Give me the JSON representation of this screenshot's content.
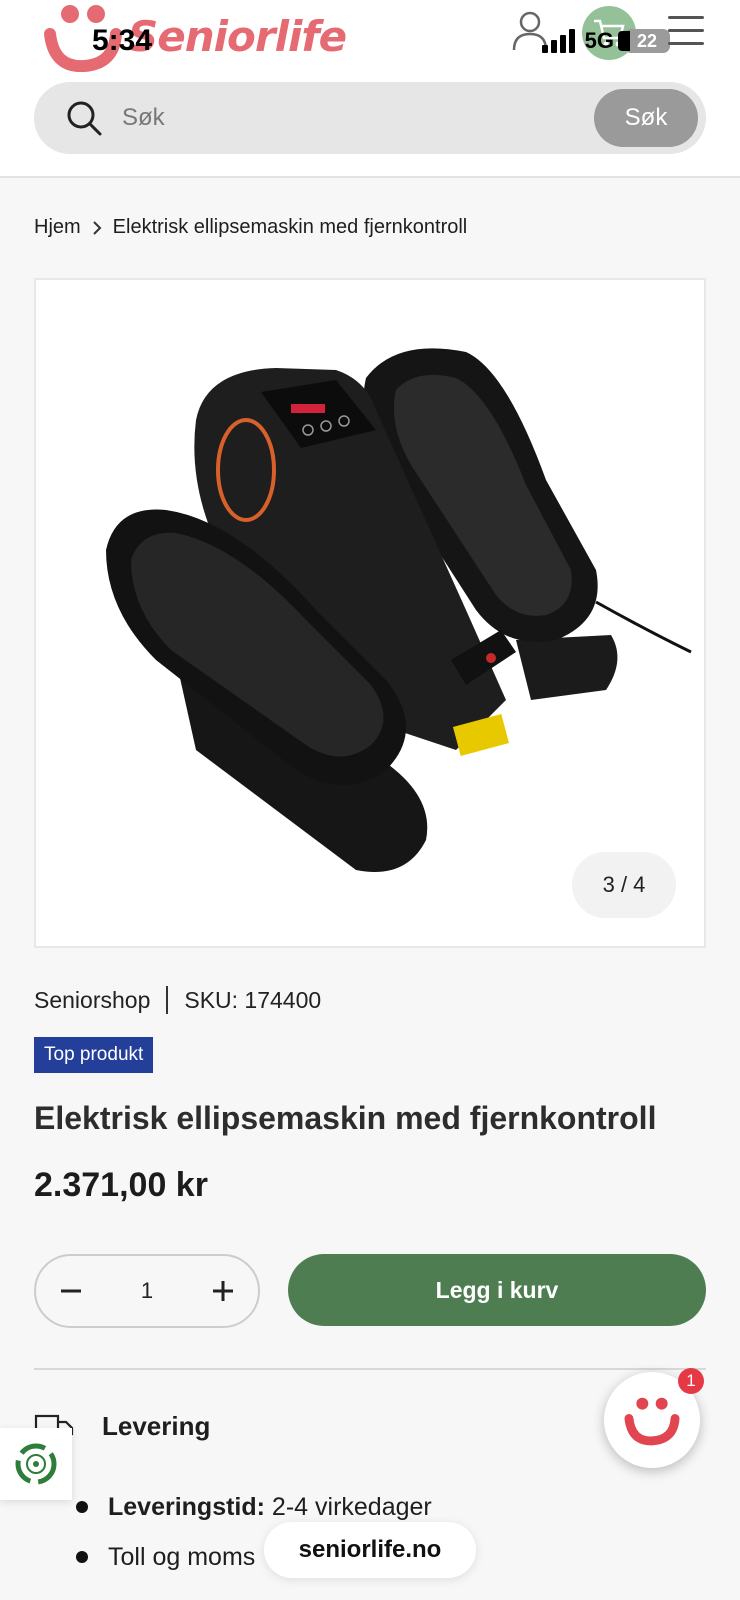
{
  "status_bar": {
    "time": "5:34",
    "network": "5G",
    "battery": "22"
  },
  "brand": {
    "name": "Seniorlife",
    "accent": "#e04550"
  },
  "search": {
    "placeholder": "Søk",
    "button_label": "Søk"
  },
  "breadcrumb": {
    "home": "Hjem",
    "current": "Elektrisk ellipsemaskin med fjernkontroll"
  },
  "gallery": {
    "pager": "3 / 4"
  },
  "product": {
    "vendor": "Seniorshop",
    "sku": "SKU: 174400",
    "badge": "Top produkt",
    "title": "Elektrisk ellipsemaskin med fjernkontroll",
    "price": "2.371,00 kr",
    "quantity": "1",
    "add_to_cart": "Legg i kurv"
  },
  "delivery": {
    "label": "Levering",
    "items": [
      {
        "bold": "Leveringstid:",
        "text": " 2-4 virkedager"
      },
      {
        "bold": "",
        "text": "Toll og moms"
      }
    ]
  },
  "browser": {
    "url": "seniorlife.no"
  },
  "chat": {
    "badge_count": "1"
  },
  "colors": {
    "cart_button": "#4f7d52",
    "badge_bg": "#243f99"
  }
}
